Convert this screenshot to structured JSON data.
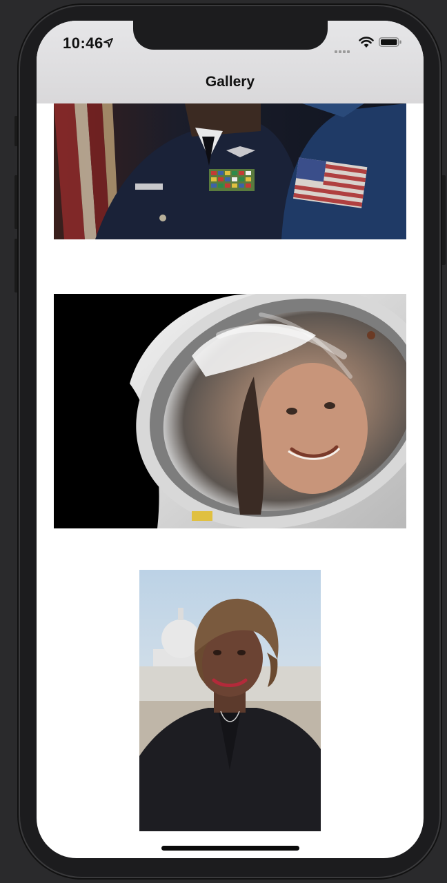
{
  "status_bar": {
    "time": "10:46",
    "icons": [
      "location-arrow-icon",
      "signal-dots-icon",
      "wifi-icon",
      "battery-icon"
    ]
  },
  "nav": {
    "title": "Gallery"
  },
  "gallery": {
    "items": [
      {
        "kind": "photo",
        "subject": "person-in-military-uniform-and-astronaut"
      },
      {
        "kind": "photo",
        "subject": "astronaut-helmet-selfie"
      },
      {
        "kind": "photo",
        "subject": "portrait-in-front-of-capitol"
      }
    ]
  },
  "colors": {
    "screen_bg": "#ffffff",
    "nav_bg": "#dedde0",
    "device": "#1c1c1e"
  }
}
